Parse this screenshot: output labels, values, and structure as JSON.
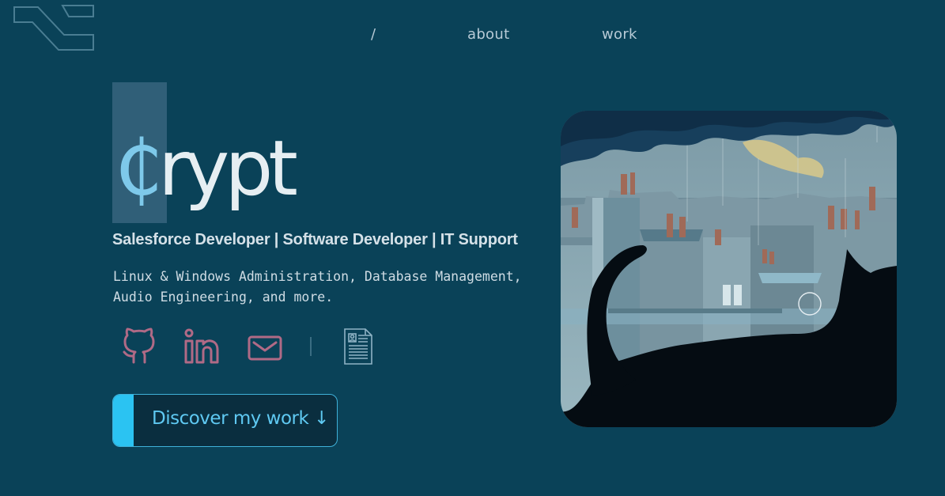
{
  "nav": {
    "items": [
      {
        "label": "/"
      },
      {
        "label": "about"
      },
      {
        "label": "work"
      }
    ]
  },
  "hero": {
    "title_first": "₵",
    "title_rest": "rypt",
    "roles": "Salesforce Developer | Software Developer | IT Support",
    "skills": "Linux & Windows Administration, Database Management, Audio Engineering, and more.",
    "cta_label": "Discover my work ↓"
  },
  "socials": [
    {
      "icon": "github-icon"
    },
    {
      "icon": "linkedin-icon"
    },
    {
      "icon": "mail-icon"
    },
    {
      "icon": "resume-icon"
    }
  ],
  "colors": {
    "background": "#0a4258",
    "accent": "#2bc3f2",
    "title_highlight": "#7ec9ea",
    "social_icon": "#b06a86"
  }
}
